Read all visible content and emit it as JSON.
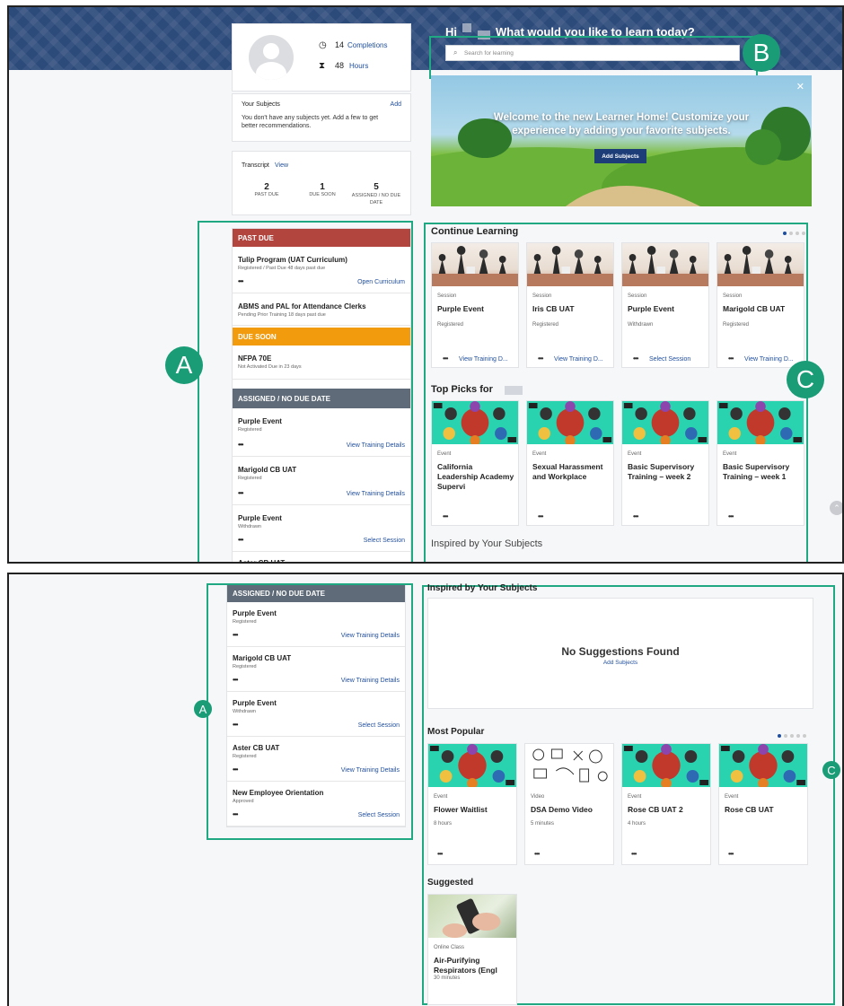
{
  "callouts": {
    "a": "A",
    "b": "B",
    "c": "C"
  },
  "profile": {
    "completions_count": "14",
    "completions_label": "Completions",
    "hours_count": "48",
    "hours_label": "Hours"
  },
  "subjects": {
    "title": "Your Subjects",
    "add": "Add",
    "empty_text": "You don't have any subjects yet. Add a few to get better recommendations."
  },
  "transcript": {
    "label": "Transcript",
    "view": "View",
    "stats": [
      {
        "value": "2",
        "label": "PAST DUE"
      },
      {
        "value": "1",
        "label": "DUE SOON"
      },
      {
        "value": "5",
        "label": "ASSIGNED / NO DUE DATE"
      }
    ]
  },
  "header": {
    "greeting": "Hi",
    "question": "What would you like to learn today?",
    "search_placeholder": "Search for learning"
  },
  "welcome": {
    "text": "Welcome to the new Learner Home! Customize your experience by adding your favorite subjects.",
    "button": "Add Subjects",
    "close": "✕"
  },
  "past_due": {
    "header": "PAST DUE",
    "items": [
      {
        "title": "Tulip Program (UAT Curriculum)",
        "sub": "Registered / Past Due    48 days past due",
        "dots": "•••",
        "action": "Open Curriculum"
      },
      {
        "title": "ABMS and PAL for Attendance Clerks",
        "sub": "Pending Prior Training    18 days past due"
      }
    ]
  },
  "due_soon": {
    "header": "DUE SOON",
    "items": [
      {
        "title": "NFPA 70E",
        "sub": "Not Activated    Due in 23 days"
      }
    ]
  },
  "assigned": {
    "header": "ASSIGNED / NO DUE DATE",
    "items": [
      {
        "title": "Purple Event",
        "sub": "Registered",
        "dots": "•••",
        "action": "View Training Details"
      },
      {
        "title": "Marigold CB UAT",
        "sub": "Registered",
        "dots": "•••",
        "action": "View Training Details"
      },
      {
        "title": "Purple Event",
        "sub": "Withdrawn",
        "dots": "•••",
        "action": "Select Session"
      },
      {
        "title": "Aster CB UAT",
        "sub": "Registered",
        "dots": "•••",
        "action": "View Training Details"
      },
      {
        "title": "New Employee Orientation",
        "sub": "Approved",
        "dots": "•••",
        "action": "Select Session"
      }
    ]
  },
  "continue_learning": {
    "title": "Continue Learning",
    "cards": [
      {
        "type": "Session",
        "title": "Purple Event",
        "status": "Registered",
        "dots": "•••",
        "action": "View Training D..."
      },
      {
        "type": "Session",
        "title": "Iris CB UAT",
        "status": "Registered",
        "dots": "•••",
        "action": "View Training D..."
      },
      {
        "type": "Session",
        "title": "Purple Event",
        "status": "Withdrawn",
        "dots": "•••",
        "action": "Select Session"
      },
      {
        "type": "Session",
        "title": "Marigold CB UAT",
        "status": "Registered",
        "dots": "•••",
        "action": "View Training D..."
      }
    ]
  },
  "top_picks": {
    "title": "Top Picks for",
    "cards": [
      {
        "type": "Event",
        "title": "California Leadership Academy Supervi",
        "dots": "•••"
      },
      {
        "type": "Event",
        "title": "Sexual Harassment and Workplace",
        "dots": "•••"
      },
      {
        "type": "Event",
        "title": "Basic Supervisory Training – week 2",
        "dots": "•••"
      },
      {
        "type": "Event",
        "title": "Basic Supervisory Training – week 1",
        "dots": "•••"
      }
    ]
  },
  "inspired": {
    "title": "Inspired by Your Subjects",
    "empty": "No Suggestions Found",
    "add": "Add Subjects"
  },
  "most_popular": {
    "title": "Most Popular",
    "cards": [
      {
        "type": "Event",
        "title": "Flower Waitlist",
        "meta": "8 hours",
        "dots": "•••"
      },
      {
        "type": "Video",
        "title": "DSA Demo Video",
        "meta": "5 minutes",
        "dots": "•••"
      },
      {
        "type": "Event",
        "title": "Rose CB UAT 2",
        "meta": "4 hours",
        "dots": "•••"
      },
      {
        "type": "Event",
        "title": "Rose CB UAT",
        "meta": "",
        "dots": "•••"
      }
    ]
  },
  "suggested": {
    "title": "Suggested",
    "cards": [
      {
        "type": "Online Class",
        "title": "Air-Purifying Respirators (Engl",
        "meta": "30 minutes"
      }
    ]
  },
  "icons": {
    "completions": "check-circle-icon",
    "hours": "hourglass-icon",
    "search": "search-icon",
    "close": "close-icon",
    "scroll_top": "chevron-up-icon"
  },
  "colors": {
    "past_due": "#b3453f",
    "due_soon": "#f29b0c",
    "assigned": "#5f6b78",
    "callout": "#1a9c76",
    "banner": "#2c4a7a"
  }
}
